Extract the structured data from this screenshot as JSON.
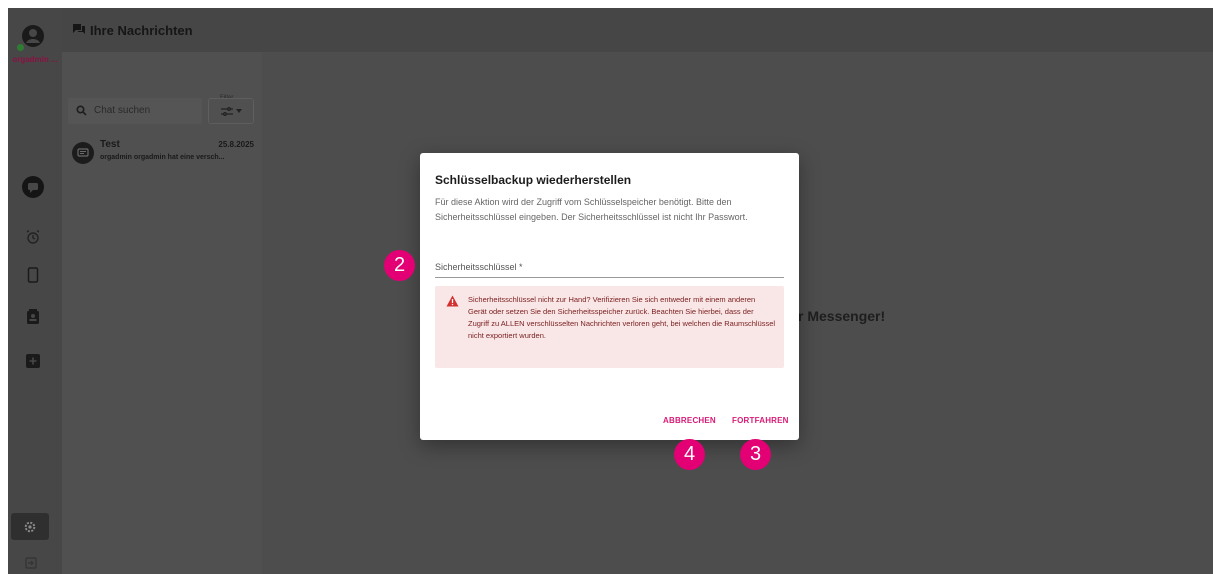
{
  "rail": {
    "user_name": "orgadmin ...",
    "accent_color": "#e20074"
  },
  "header": {
    "title": "Ihre Nachrichten"
  },
  "chatlist": {
    "search_placeholder": "Chat suchen",
    "filter_label": "Filter",
    "items": [
      {
        "name": "Test",
        "date": "25.8.2025",
        "preview": "orgadmin orgadmin hat eine versch..."
      }
    ]
  },
  "background": {
    "welcome_fragment": "r Messenger!"
  },
  "dialog": {
    "title": "Schlüsselbackup wiederherstellen",
    "description": "Für diese Aktion wird der Zugriff vom Schlüsselspeicher benötigt. Bitte den Sicherheitsschlüssel eingeben. Der Sicherheitsschlüssel ist nicht Ihr Passwort.",
    "key_field_label": "Sicherheitsschlüssel *",
    "warning": "Sicherheitsschlüssel nicht zur Hand? Verifizieren Sie sich entweder mit einem anderen Gerät oder setzen Sie den Sicherheitsspeicher zurück. Beachten Sie hierbei, dass der Zugriff zu ALLEN verschlüsselten Nachrichten verloren geht, bei welchen die Raumschlüssel nicht exportiert wurden.",
    "cancel_label": "ABBRECHEN",
    "continue_label": "FORTFAHREN"
  },
  "markers": {
    "field": "2",
    "continue": "3",
    "cancel": "4"
  }
}
